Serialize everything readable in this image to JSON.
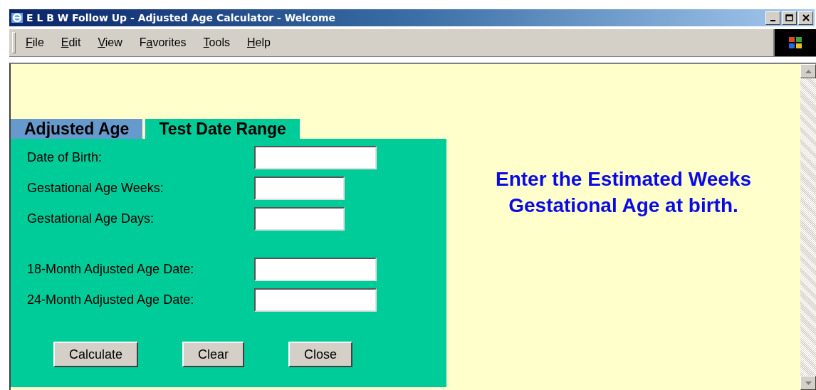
{
  "window": {
    "title": "E L B W Follow Up - Adjusted Age Calculator - Welcome"
  },
  "menu": [
    {
      "parts": [
        {
          "text": "F",
          "underlined": true
        },
        {
          "text": "ile",
          "underlined": false
        }
      ]
    },
    {
      "parts": [
        {
          "text": "E",
          "underlined": true
        },
        {
          "text": "dit",
          "underlined": false
        }
      ]
    },
    {
      "parts": [
        {
          "text": "V",
          "underlined": true
        },
        {
          "text": "iew",
          "underlined": false
        }
      ]
    },
    {
      "parts": [
        {
          "text": "F",
          "underlined": false
        },
        {
          "text": "a",
          "underlined": true
        },
        {
          "text": "vorites",
          "underlined": false
        }
      ]
    },
    {
      "parts": [
        {
          "text": "T",
          "underlined": true
        },
        {
          "text": "ools",
          "underlined": false
        }
      ]
    },
    {
      "parts": [
        {
          "text": "H",
          "underlined": true
        },
        {
          "text": "elp",
          "underlined": false
        }
      ]
    }
  ],
  "tabs": [
    {
      "label": "Adjusted Age",
      "selected": false
    },
    {
      "label": "Test Date Range",
      "selected": true
    }
  ],
  "form": {
    "groups": [
      [
        {
          "label": "Date of Birth:",
          "kind": "date"
        },
        {
          "label": "Gestational Age Weeks:",
          "kind": "short"
        },
        {
          "label": "Gestational Age Days:",
          "kind": "short"
        }
      ],
      [
        {
          "label": "18-Month Adjusted Age Date:",
          "kind": "date"
        },
        {
          "label": "24-Month Adjusted Age Date:",
          "kind": "date"
        }
      ]
    ],
    "buttons": [
      "Calculate",
      "Clear",
      "Close"
    ]
  },
  "message": "Enter the Estimated Weeks\nGestational Age at birth."
}
